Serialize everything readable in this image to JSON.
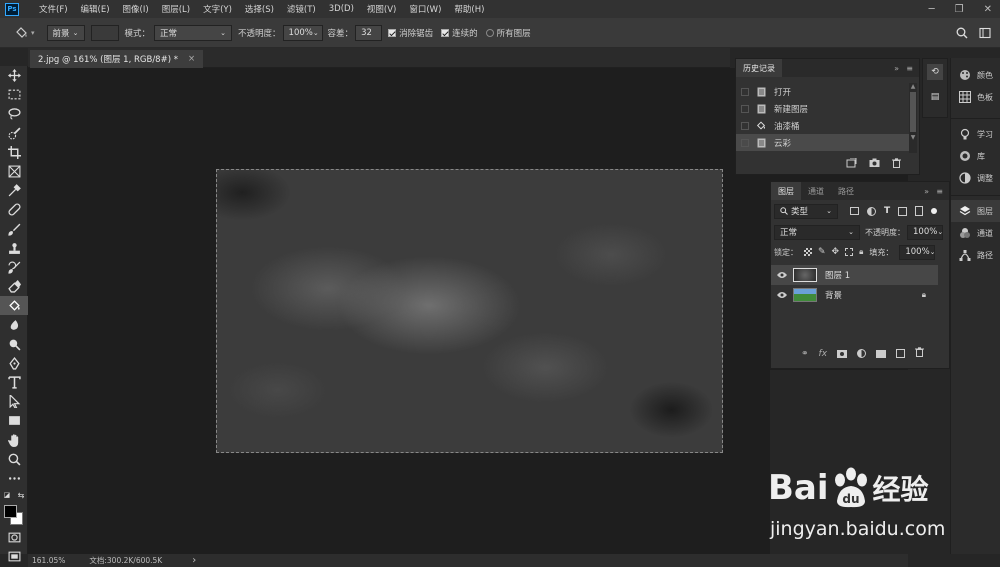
{
  "app": {
    "logo": "Ps"
  },
  "menu": [
    "文件(F)",
    "编辑(E)",
    "图像(I)",
    "图层(L)",
    "文字(Y)",
    "选择(S)",
    "滤镜(T)",
    "3D(D)",
    "视图(V)",
    "窗口(W)",
    "帮助(H)"
  ],
  "options": {
    "fill_source": "前景",
    "mode_label": "模式：",
    "mode_value": "正常",
    "opacity_label": "不透明度：",
    "opacity_value": "100%",
    "tolerance_label": "容差：",
    "tolerance_value": "32",
    "antialias_label": "消除锯齿",
    "contiguous_label": "连续的",
    "all_layers_label": "所有图层"
  },
  "document": {
    "tab_title": "2.jpg @ 161% (图层 1, RGB/8#) *",
    "close": "×"
  },
  "status": {
    "zoom": "161.05%",
    "doc_info": "文档:300.2K/600.5K",
    "arrow": "›"
  },
  "history_panel": {
    "title": "历史记录",
    "items": [
      {
        "label": "打开",
        "icon": "document-icon",
        "selected": false
      },
      {
        "label": "新建图层",
        "icon": "document-icon",
        "selected": false
      },
      {
        "label": "油漆桶",
        "icon": "paint-bucket-icon",
        "selected": false
      },
      {
        "label": "云彩",
        "icon": "document-icon",
        "selected": true
      }
    ]
  },
  "layers_panel": {
    "tabs": [
      "图层",
      "通道",
      "路径"
    ],
    "filter_label": "类型",
    "blend_mode": "正常",
    "opacity_label": "不透明度：",
    "opacity_value": "100%",
    "lock_label": "锁定：",
    "fill_label": "填充：",
    "fill_value": "100%",
    "layers": [
      {
        "name": "图层 1",
        "selected": true,
        "locked": false
      },
      {
        "name": "背景",
        "selected": false,
        "locked": true
      }
    ]
  },
  "side_dock": {
    "group1": [
      "颜色",
      "色板"
    ],
    "group2": [
      "学习",
      "库",
      "调整"
    ],
    "group3": [
      "图层",
      "通道",
      "路径"
    ]
  },
  "watermark": {
    "brand_left": "Bai",
    "brand_right": "经验",
    "url": "jingyan.baidu.com"
  },
  "colors": {
    "accent": "#31a8ff",
    "menu_bg": "#323232",
    "panel_bg": "#323232",
    "workspace": "#1e1e1e"
  }
}
